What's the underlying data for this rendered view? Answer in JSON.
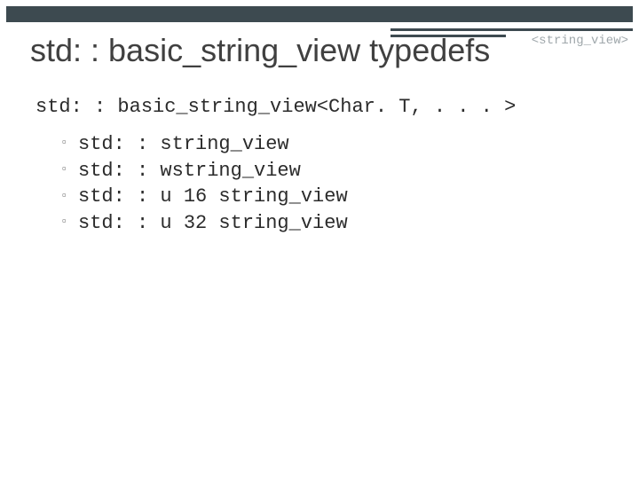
{
  "header_tag": "<string_view>",
  "title": "std: : basic_string_view typedefs",
  "subheading": "std: : basic_string_view<Char. T, . . . >",
  "items": [
    "std: : string_view",
    "std: : wstring_view",
    "std: : u 16 string_view",
    "std: : u 32 string_view"
  ]
}
